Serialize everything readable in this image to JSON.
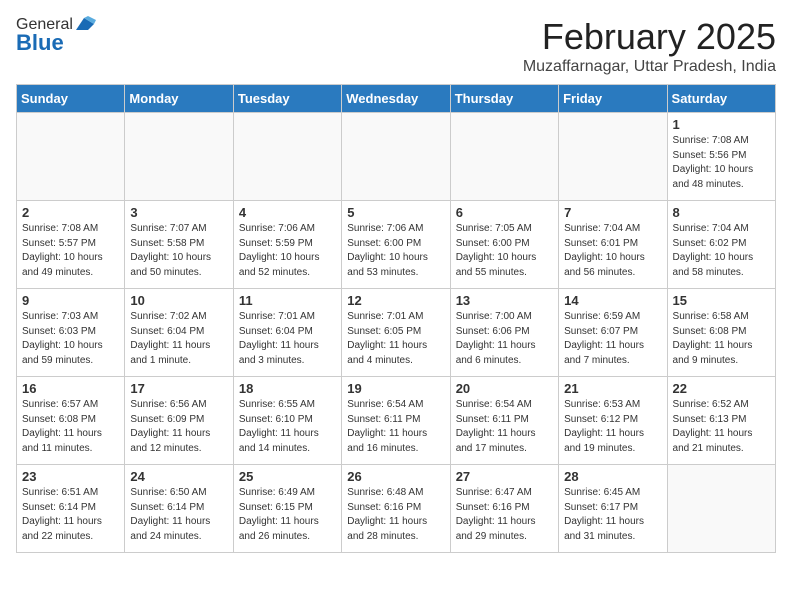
{
  "header": {
    "logo_general": "General",
    "logo_blue": "Blue",
    "month": "February 2025",
    "location": "Muzaffarnagar, Uttar Pradesh, India"
  },
  "weekdays": [
    "Sunday",
    "Monday",
    "Tuesday",
    "Wednesday",
    "Thursday",
    "Friday",
    "Saturday"
  ],
  "weeks": [
    [
      {
        "day": "",
        "info": ""
      },
      {
        "day": "",
        "info": ""
      },
      {
        "day": "",
        "info": ""
      },
      {
        "day": "",
        "info": ""
      },
      {
        "day": "",
        "info": ""
      },
      {
        "day": "",
        "info": ""
      },
      {
        "day": "1",
        "info": "Sunrise: 7:08 AM\nSunset: 5:56 PM\nDaylight: 10 hours\nand 48 minutes."
      }
    ],
    [
      {
        "day": "2",
        "info": "Sunrise: 7:08 AM\nSunset: 5:57 PM\nDaylight: 10 hours\nand 49 minutes."
      },
      {
        "day": "3",
        "info": "Sunrise: 7:07 AM\nSunset: 5:58 PM\nDaylight: 10 hours\nand 50 minutes."
      },
      {
        "day": "4",
        "info": "Sunrise: 7:06 AM\nSunset: 5:59 PM\nDaylight: 10 hours\nand 52 minutes."
      },
      {
        "day": "5",
        "info": "Sunrise: 7:06 AM\nSunset: 6:00 PM\nDaylight: 10 hours\nand 53 minutes."
      },
      {
        "day": "6",
        "info": "Sunrise: 7:05 AM\nSunset: 6:00 PM\nDaylight: 10 hours\nand 55 minutes."
      },
      {
        "day": "7",
        "info": "Sunrise: 7:04 AM\nSunset: 6:01 PM\nDaylight: 10 hours\nand 56 minutes."
      },
      {
        "day": "8",
        "info": "Sunrise: 7:04 AM\nSunset: 6:02 PM\nDaylight: 10 hours\nand 58 minutes."
      }
    ],
    [
      {
        "day": "9",
        "info": "Sunrise: 7:03 AM\nSunset: 6:03 PM\nDaylight: 10 hours\nand 59 minutes."
      },
      {
        "day": "10",
        "info": "Sunrise: 7:02 AM\nSunset: 6:04 PM\nDaylight: 11 hours\nand 1 minute."
      },
      {
        "day": "11",
        "info": "Sunrise: 7:01 AM\nSunset: 6:04 PM\nDaylight: 11 hours\nand 3 minutes."
      },
      {
        "day": "12",
        "info": "Sunrise: 7:01 AM\nSunset: 6:05 PM\nDaylight: 11 hours\nand 4 minutes."
      },
      {
        "day": "13",
        "info": "Sunrise: 7:00 AM\nSunset: 6:06 PM\nDaylight: 11 hours\nand 6 minutes."
      },
      {
        "day": "14",
        "info": "Sunrise: 6:59 AM\nSunset: 6:07 PM\nDaylight: 11 hours\nand 7 minutes."
      },
      {
        "day": "15",
        "info": "Sunrise: 6:58 AM\nSunset: 6:08 PM\nDaylight: 11 hours\nand 9 minutes."
      }
    ],
    [
      {
        "day": "16",
        "info": "Sunrise: 6:57 AM\nSunset: 6:08 PM\nDaylight: 11 hours\nand 11 minutes."
      },
      {
        "day": "17",
        "info": "Sunrise: 6:56 AM\nSunset: 6:09 PM\nDaylight: 11 hours\nand 12 minutes."
      },
      {
        "day": "18",
        "info": "Sunrise: 6:55 AM\nSunset: 6:10 PM\nDaylight: 11 hours\nand 14 minutes."
      },
      {
        "day": "19",
        "info": "Sunrise: 6:54 AM\nSunset: 6:11 PM\nDaylight: 11 hours\nand 16 minutes."
      },
      {
        "day": "20",
        "info": "Sunrise: 6:54 AM\nSunset: 6:11 PM\nDaylight: 11 hours\nand 17 minutes."
      },
      {
        "day": "21",
        "info": "Sunrise: 6:53 AM\nSunset: 6:12 PM\nDaylight: 11 hours\nand 19 minutes."
      },
      {
        "day": "22",
        "info": "Sunrise: 6:52 AM\nSunset: 6:13 PM\nDaylight: 11 hours\nand 21 minutes."
      }
    ],
    [
      {
        "day": "23",
        "info": "Sunrise: 6:51 AM\nSunset: 6:14 PM\nDaylight: 11 hours\nand 22 minutes."
      },
      {
        "day": "24",
        "info": "Sunrise: 6:50 AM\nSunset: 6:14 PM\nDaylight: 11 hours\nand 24 minutes."
      },
      {
        "day": "25",
        "info": "Sunrise: 6:49 AM\nSunset: 6:15 PM\nDaylight: 11 hours\nand 26 minutes."
      },
      {
        "day": "26",
        "info": "Sunrise: 6:48 AM\nSunset: 6:16 PM\nDaylight: 11 hours\nand 28 minutes."
      },
      {
        "day": "27",
        "info": "Sunrise: 6:47 AM\nSunset: 6:16 PM\nDaylight: 11 hours\nand 29 minutes."
      },
      {
        "day": "28",
        "info": "Sunrise: 6:45 AM\nSunset: 6:17 PM\nDaylight: 11 hours\nand 31 minutes."
      },
      {
        "day": "",
        "info": ""
      }
    ]
  ]
}
